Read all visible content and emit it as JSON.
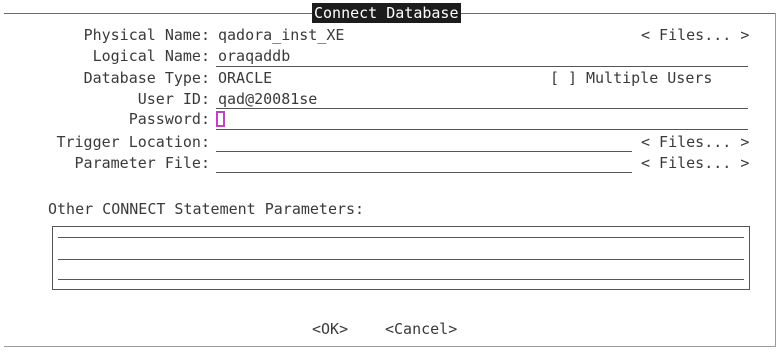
{
  "dialog": {
    "title": "Connect Database"
  },
  "fields": {
    "physical_name": {
      "label": "Physical Name:",
      "value": "qadora_inst_XE",
      "files": "< Files... >"
    },
    "logical_name": {
      "label": "Logical Name:",
      "value": "oraqaddb"
    },
    "database_type": {
      "label": "Database Type:",
      "value": "ORACLE"
    },
    "multiple_users": {
      "checkbox": "[ ]",
      "label": "Multiple Users"
    },
    "user_id": {
      "label": "User ID:",
      "value": "qad@20081se"
    },
    "password": {
      "label": "Password:",
      "value": ""
    },
    "trigger_location": {
      "label": "Trigger Location:",
      "value": "",
      "files": "< Files... >"
    },
    "parameter_file": {
      "label": "Parameter File:",
      "value": "",
      "files": "< Files... >"
    }
  },
  "other_params": {
    "label": "Other CONNECT Statement Parameters:",
    "lines": [
      "",
      "",
      ""
    ]
  },
  "buttons": {
    "ok": "<OK>",
    "cancel": "<Cancel>"
  }
}
